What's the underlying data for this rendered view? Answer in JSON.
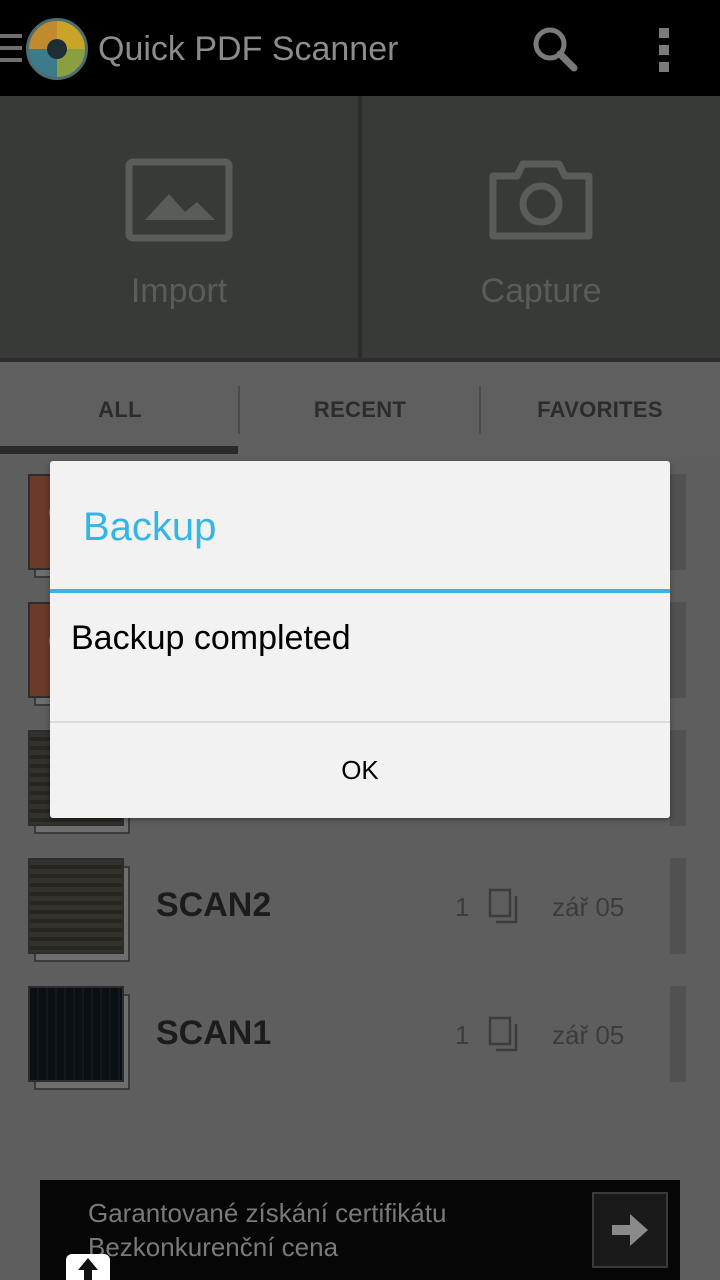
{
  "app_bar": {
    "title": "Quick PDF Scanner",
    "icons": [
      "menu-icon",
      "app-logo-icon",
      "search-icon",
      "overflow-menu-icon"
    ]
  },
  "big_buttons": {
    "import_label": "Import",
    "import_icon": "image-icon",
    "capture_label": "Capture",
    "capture_icon": "camera-icon"
  },
  "tabs": [
    {
      "label": "ALL",
      "selected": true
    },
    {
      "label": "RECENT",
      "selected": false
    },
    {
      "label": "FAVORITES",
      "selected": false
    }
  ],
  "documents": [
    {
      "name": "SCAN2",
      "pages": "1",
      "date": "zář 05",
      "thumbnail": "document-photo"
    },
    {
      "name": "SCAN1",
      "pages": "1",
      "date": "zář 05",
      "thumbnail": "dark-photo"
    }
  ],
  "ad": {
    "line1": "Garantované získání certifikátu",
    "line2": "Bezkonkurenční cena",
    "icon": "arrow-right-icon"
  },
  "dialog": {
    "title": "Backup",
    "message": "Backup completed",
    "ok_label": "OK"
  },
  "colors": {
    "accent": "#33b5e5",
    "action_bar": "#000000",
    "dim_overlay_bg": "#5e5e5e",
    "dialog_bg": "#f2f2f2"
  }
}
